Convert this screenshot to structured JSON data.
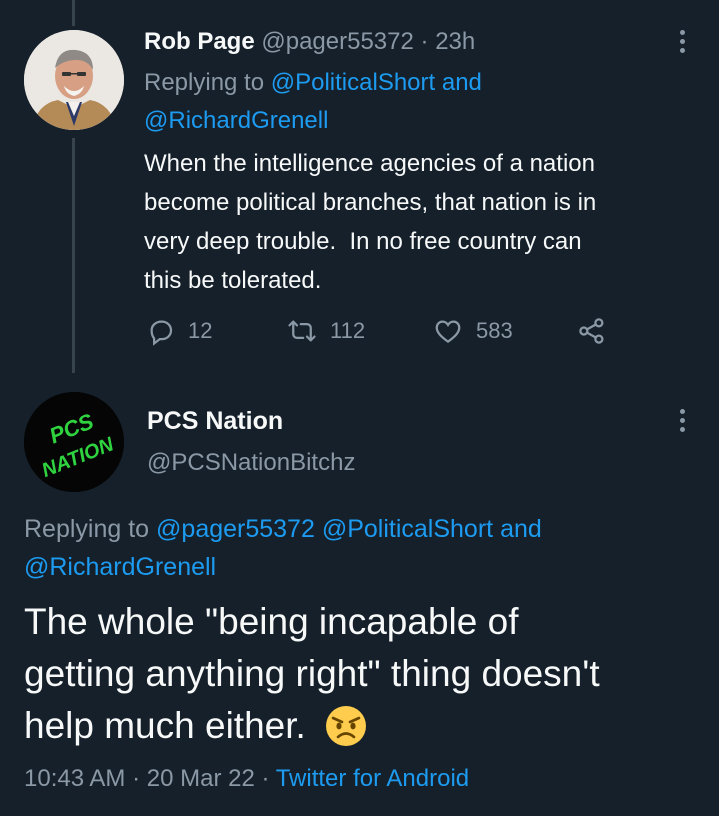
{
  "reply_tweet": {
    "name": "Rob Page",
    "handle": "@pager55372",
    "sep": "·",
    "time": "23h",
    "replying_prefix": "Replying to",
    "reply_to_1": "@PoliticalShort",
    "reply_and": "and",
    "reply_to_2": "@RichardGrenell",
    "text_lines": [
      "When the intelligence agencies of a nation",
      "become political branches, that nation is in",
      "very deep trouble.  In no free country can",
      "this be tolerated."
    ],
    "replies": "12",
    "retweets": "112",
    "likes": "583"
  },
  "main_tweet": {
    "avatar_text_1": "PCS",
    "avatar_text_2": "NATION",
    "name": "PCS Nation",
    "handle": "@PCSNationBitchz",
    "replying_prefix": "Replying to",
    "reply_to_1": "@pager55372",
    "reply_to_2": "@PoliticalShort",
    "reply_and": "and",
    "reply_to_3": "@RichardGrenell",
    "text_lines": [
      "The whole \"being incapable of",
      "getting anything right\" thing doesn't",
      "help much either."
    ],
    "emoji": "angry-face",
    "time": "10:43 AM",
    "sep1": "·",
    "date": "20 Mar 22",
    "sep2": "·",
    "source": "Twitter for Android"
  },
  "colors": {
    "background": "#15202b",
    "text": "#f7f9f9",
    "muted": "#8b98a5",
    "link": "#1d9bf0",
    "avatar_green": "#2fd33f"
  }
}
